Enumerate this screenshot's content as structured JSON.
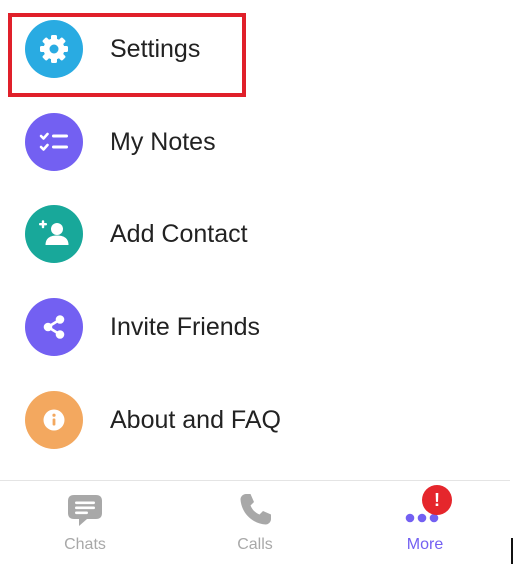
{
  "colors": {
    "settings_icon_bg": "#29abe2",
    "notes_icon_bg": "#7360f2",
    "contact_icon_bg": "#18a89a",
    "invite_icon_bg": "#7360f2",
    "about_icon_bg": "#f3a85f",
    "highlight_border": "#e0202a",
    "active_tab": "#7360f2",
    "inactive_tab": "#a8a8a8",
    "badge": "#e5262c"
  },
  "menu": {
    "items": [
      {
        "label": "Settings",
        "icon": "gear-icon"
      },
      {
        "label": "My Notes",
        "icon": "notes-checklist-icon"
      },
      {
        "label": "Add Contact",
        "icon": "add-person-icon"
      },
      {
        "label": "Invite Friends",
        "icon": "share-icon"
      },
      {
        "label": "About and FAQ",
        "icon": "info-icon"
      }
    ]
  },
  "tabbar": {
    "tabs": [
      {
        "label": "Chats",
        "icon": "chat-bubble-icon",
        "active": false
      },
      {
        "label": "Calls",
        "icon": "phone-icon",
        "active": false
      },
      {
        "label": "More",
        "icon": "more-dots-icon",
        "active": true
      }
    ],
    "badge_text": "!"
  }
}
